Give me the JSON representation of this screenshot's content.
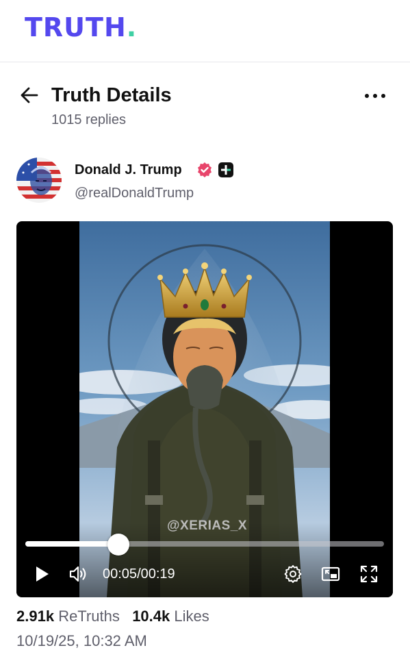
{
  "app": {
    "logo_text": "TRUTH",
    "logo_dot": ".",
    "brand_color": "#5448ee",
    "accent_color": "#3fd0a4"
  },
  "header": {
    "title": "Truth Details",
    "replies": "1015 replies",
    "back_icon": "arrow-left-icon",
    "more_icon": "more-horizontal-icon"
  },
  "author": {
    "name": "Donald J. Trump",
    "handle": "@realDonaldTrump",
    "verified_icon": "verified-badge-icon",
    "verified_color": "#e8456b",
    "plus_icon": "truth-plus-badge-icon"
  },
  "video": {
    "watermark": "@XERIAS_X",
    "current_time": "00:05",
    "separator": "/",
    "duration": "00:19",
    "progress_fraction": 0.26,
    "controls": [
      "play-icon",
      "volume-icon",
      "settings-icon",
      "picture-in-picture-icon",
      "fullscreen-icon"
    ]
  },
  "stats": {
    "retruths_count": "2.91k",
    "retruths_label": "ReTruths",
    "likes_count": "10.4k",
    "likes_label": "Likes",
    "timestamp": "10/19/25, 10:32 AM"
  }
}
